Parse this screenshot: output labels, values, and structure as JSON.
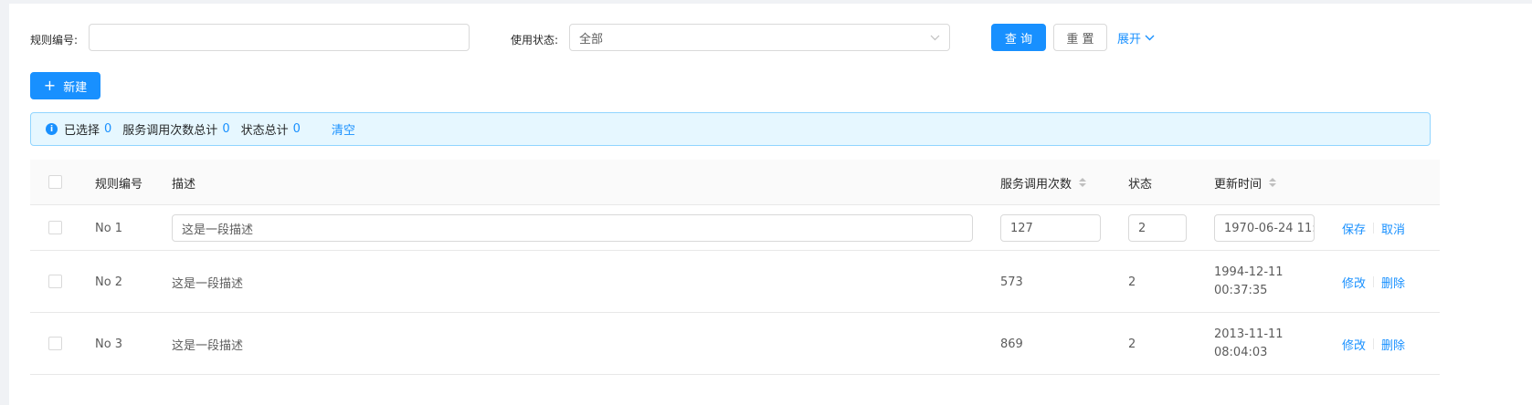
{
  "search": {
    "rule_label": "规则编号:",
    "rule_value": "",
    "status_label": "使用状态:",
    "status_value": "全部",
    "query_label": "查 询",
    "reset_label": "重 置",
    "expand_label": "展开"
  },
  "toolbar": {
    "new_label": "新建"
  },
  "alert": {
    "selected_label": "已选择",
    "selected_count": "0",
    "calls_label": "服务调用次数总计",
    "calls_total": "0",
    "status_label": "状态总计",
    "status_total": "0",
    "clear_label": "清空"
  },
  "table": {
    "columns": [
      "规则编号",
      "描述",
      "服务调用次数",
      "状态",
      "更新时间"
    ],
    "rows": [
      {
        "id": "No 1",
        "desc": "这是一段描述",
        "calls": "127",
        "status": "2",
        "updated": "1970-06-24 11:",
        "action1": "保存",
        "action2": "取消",
        "editing": true
      },
      {
        "id": "No 2",
        "desc": "这是一段描述",
        "calls": "573",
        "status": "2",
        "updated_date": "1994-12-11",
        "updated_time": "00:37:35",
        "action1": "修改",
        "action2": "删除"
      },
      {
        "id": "No 3",
        "desc": "这是一段描述",
        "calls": "869",
        "status": "2",
        "updated_date": "2013-11-11",
        "updated_time": "08:04:03",
        "action1": "修改",
        "action2": "删除"
      }
    ]
  },
  "colors": {
    "primary": "#1890ff",
    "alert_bg": "#e6f7ff",
    "alert_border": "#91d5ff"
  }
}
